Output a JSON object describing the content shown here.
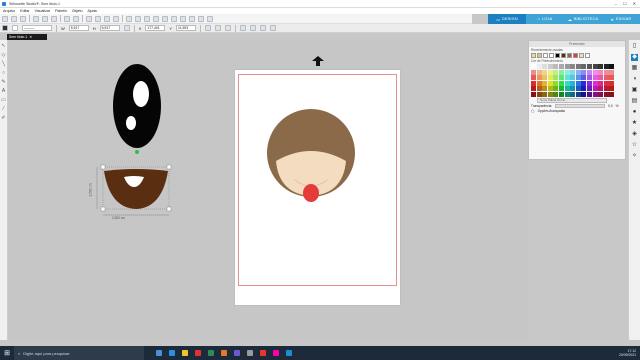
{
  "window": {
    "title": "Silhouette Studio®: Sem titulo-1",
    "controls": [
      "–",
      "☐",
      "✕"
    ]
  },
  "menu": [
    "Arquivo",
    "Editar",
    "Visualizar",
    "Painéis",
    "Objeto",
    "Ajuda"
  ],
  "tabs": [
    {
      "label": "DESIGN",
      "icon": "design-icon"
    },
    {
      "label": "LOJA",
      "icon": "store-icon"
    },
    {
      "label": "BIBLIOTECA",
      "icon": "library-icon"
    },
    {
      "label": "ENVIAR",
      "icon": "send-icon"
    }
  ],
  "toolbar2": {
    "w": "5,517",
    "h": "5,517",
    "x": "177,401",
    "y": "11,593"
  },
  "doc_tab": {
    "label": "Sem título-1"
  },
  "dimensions": {
    "width": "2,500 cm",
    "height": "1,500 cm"
  },
  "panel": {
    "title": "Preencher",
    "recent_label": "Recentemente usadas",
    "palette_label": "Cor de Preenchimento",
    "add_palette_placeholder": "Nova Paleta Nome...",
    "transparency_label": "Transparência:",
    "transparency_value": "0,0",
    "transparency_unit": "%",
    "advanced_label": "Opções Avançadas"
  },
  "taskbar": {
    "search_placeholder": "Digite aqui para pesquisar",
    "time": "17:12",
    "date": "20/09/2021"
  },
  "colors": {
    "accent": "#1b7fc0",
    "face": "#8a6a48",
    "chin": "#f3dcc0",
    "tongue": "#e63b3b",
    "dark_brown": "#5a2e10"
  }
}
